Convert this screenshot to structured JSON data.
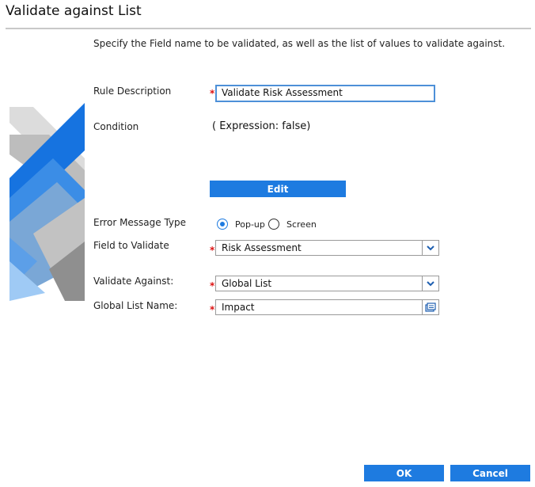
{
  "dialog": {
    "title": "Validate against List",
    "instructions": "Specify the Field name to be validated, as well as the list of values to validate against."
  },
  "form": {
    "rule_description": {
      "label": "Rule Description",
      "value": "Validate Risk Assessment"
    },
    "condition": {
      "label": "Condition",
      "value": "( Expression: false)"
    },
    "edit_label": "Edit",
    "error_message_type": {
      "label": "Error Message Type",
      "options": [
        "Pop-up",
        "Screen"
      ],
      "selected": "Pop-up"
    },
    "field_to_validate": {
      "label": "Field to Validate",
      "value": "Risk Assessment"
    },
    "validate_against": {
      "label": "Validate Against:",
      "value": "Global List"
    },
    "global_list_name": {
      "label": "Global List Name:",
      "value": "Impact"
    },
    "required_mark": "*"
  },
  "footer": {
    "ok_label": "OK",
    "cancel_label": "Cancel"
  },
  "colors": {
    "accent": "#1e7be0",
    "required": "#dd1111"
  },
  "icons": {
    "dropdown": "chevron-down-icon",
    "list_picker": "list-picker-icon"
  }
}
